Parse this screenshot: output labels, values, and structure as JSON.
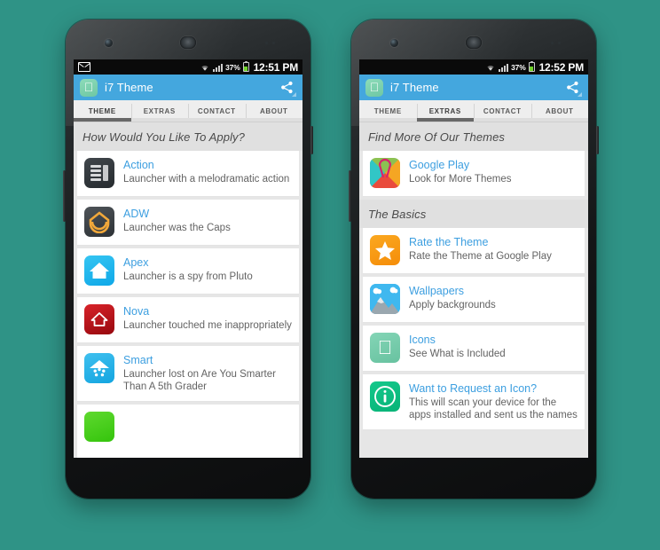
{
  "theme": {
    "page_background": "#2f9386",
    "action_bar": "#44a7de",
    "link_blue": "#3d9fe0",
    "status_bar": "#0a0a0a",
    "battery_green": "#6fd12a"
  },
  "phones": [
    {
      "id": "left",
      "status_bar": {
        "notification_icon": "mail-icon",
        "wifi_icon": "wifi-icon",
        "signal_icon": "signal-icon",
        "battery_percent": "37%",
        "battery_icon": "battery-icon",
        "clock": "12:51 PM"
      },
      "action_bar": {
        "app_icon": "apple-app-icon",
        "app_icon_glyph": "",
        "title": "i7 Theme",
        "share_icon": "share-icon"
      },
      "tabs": [
        {
          "label": "THEME",
          "active": true
        },
        {
          "label": "EXTRAS",
          "active": false
        },
        {
          "label": "CONTACT",
          "active": false
        },
        {
          "label": "ABOUT",
          "active": false
        }
      ],
      "sections": [
        {
          "header": "How Would You Like To Apply?",
          "items": [
            {
              "icon": "action-launcher-icon",
              "title": "Action",
              "subtitle": "Launcher with a melodramatic action"
            },
            {
              "icon": "adw-launcher-icon",
              "title": "ADW",
              "subtitle": "Launcher was the Caps"
            },
            {
              "icon": "apex-launcher-icon",
              "title": "Apex",
              "subtitle": "Launcher is a spy from Pluto"
            },
            {
              "icon": "nova-launcher-icon",
              "title": "Nova",
              "subtitle": "Launcher touched me inappropriately"
            },
            {
              "icon": "smart-launcher-icon",
              "title": "Smart",
              "subtitle": "Launcher lost on Are You Smarter Than A 5th Grader"
            }
          ]
        }
      ]
    },
    {
      "id": "right",
      "status_bar": {
        "notification_icon": "",
        "wifi_icon": "wifi-icon",
        "signal_icon": "signal-icon",
        "battery_percent": "37%",
        "battery_icon": "battery-icon",
        "clock": "12:52 PM"
      },
      "action_bar": {
        "app_icon": "apple-app-icon",
        "app_icon_glyph": "",
        "title": "i7 Theme",
        "share_icon": "share-icon"
      },
      "tabs": [
        {
          "label": "THEME",
          "active": false
        },
        {
          "label": "EXTRAS",
          "active": true
        },
        {
          "label": "CONTACT",
          "active": false
        },
        {
          "label": "ABOUT",
          "active": false
        }
      ],
      "sections": [
        {
          "header": "Find More Of Our Themes",
          "items": [
            {
              "icon": "google-play-icon",
              "title": "Google Play",
              "subtitle": "Look for More Themes"
            }
          ]
        },
        {
          "header": "The Basics",
          "items": [
            {
              "icon": "star-icon",
              "title": "Rate the Theme",
              "subtitle": "Rate the Theme at Google Play"
            },
            {
              "icon": "wallpapers-icon",
              "title": "Wallpapers",
              "subtitle": "Apply backgrounds"
            },
            {
              "icon": "apple-icons-icon",
              "title": "Icons",
              "subtitle": "See What is Included"
            },
            {
              "icon": "info-icon",
              "title": "Want to Request an Icon?",
              "subtitle": "This will scan your device for the apps installed and sent us the names"
            }
          ]
        }
      ]
    }
  ]
}
